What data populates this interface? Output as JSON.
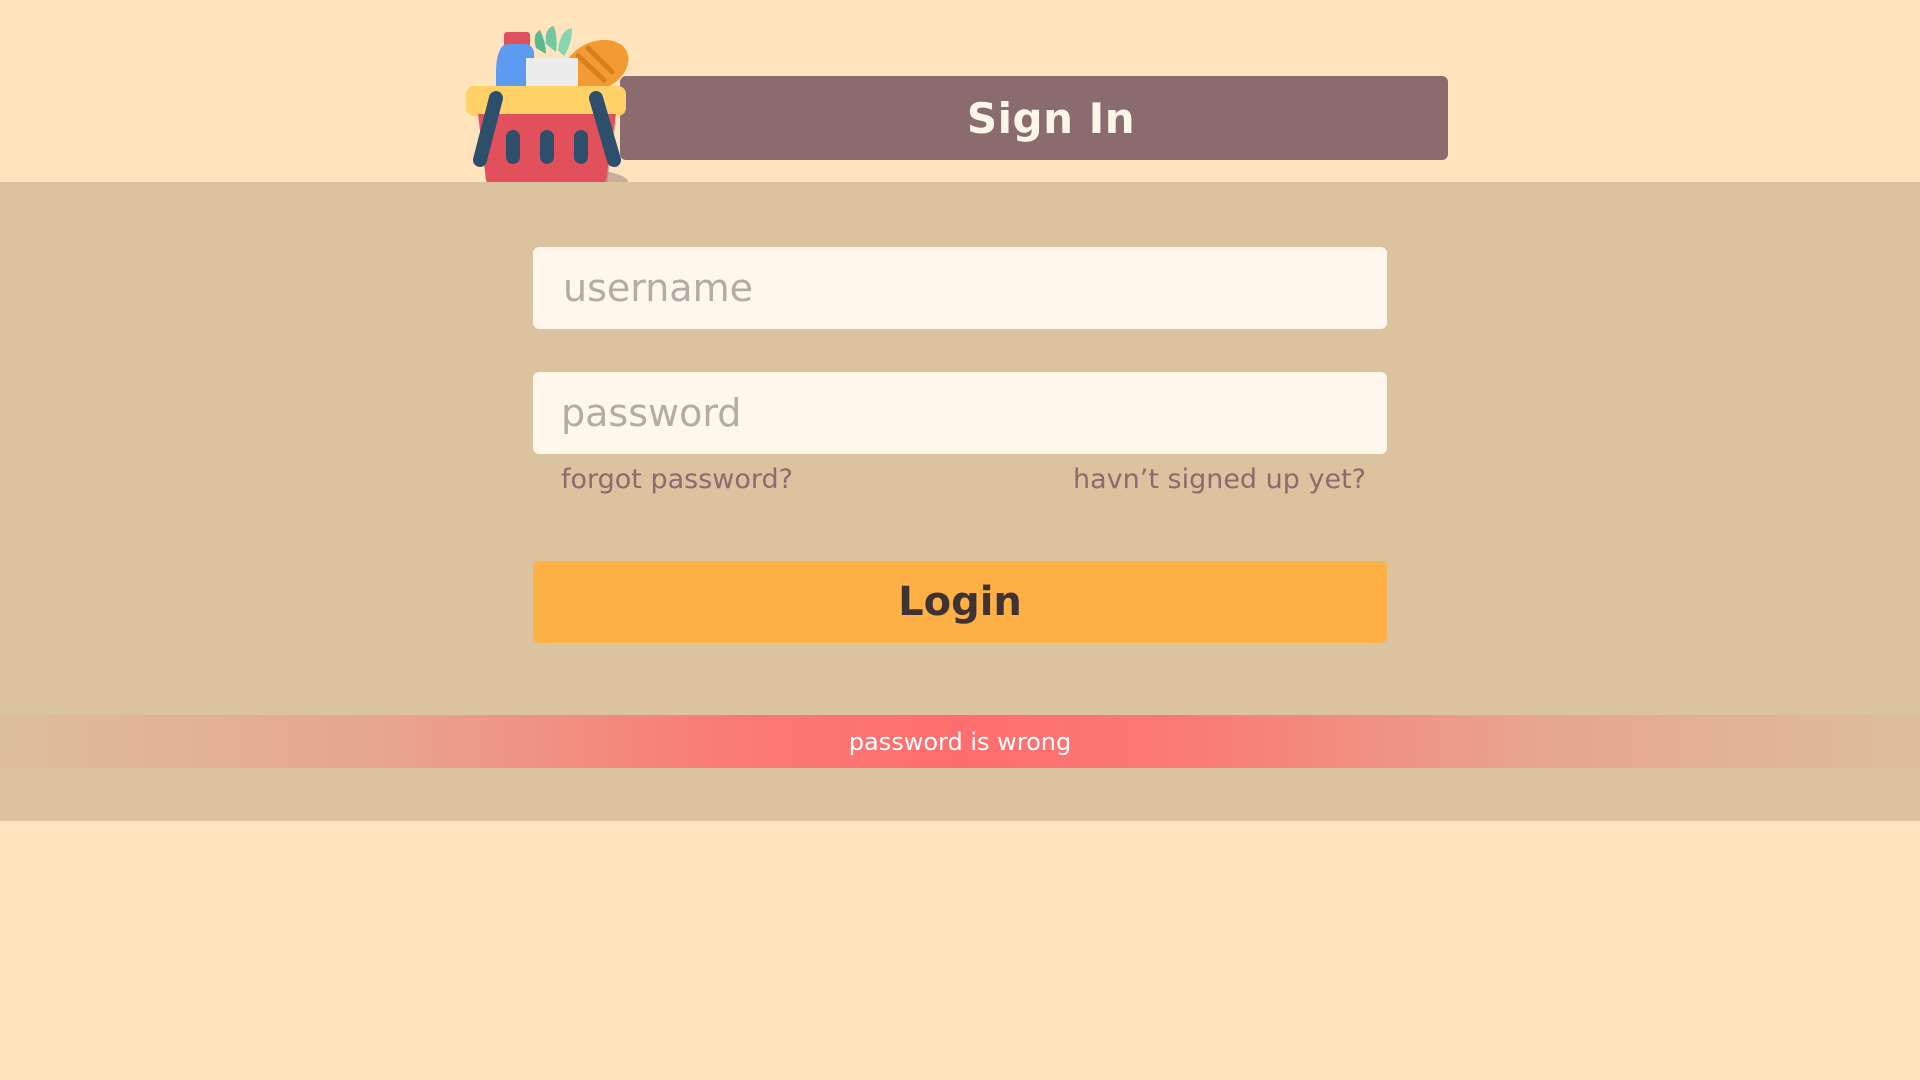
{
  "header": {
    "title": "Sign In",
    "logo_icon": "grocery-basket-icon"
  },
  "form": {
    "username": {
      "value": "",
      "placeholder": "username"
    },
    "password": {
      "value": "",
      "placeholder": "password"
    },
    "forgot_password_label": "forgot password?",
    "signup_label": "havn’t signed up yet?",
    "login_label": "Login"
  },
  "error": {
    "message": "password is wrong"
  },
  "colors": {
    "page_background": "#FFE4BD",
    "band_background": "#DBC39F",
    "header_bar": "#8A6B6E",
    "input_background": "#FFF7EB",
    "login_button": "#FFB045",
    "error_bar": "#FF6E6E"
  }
}
